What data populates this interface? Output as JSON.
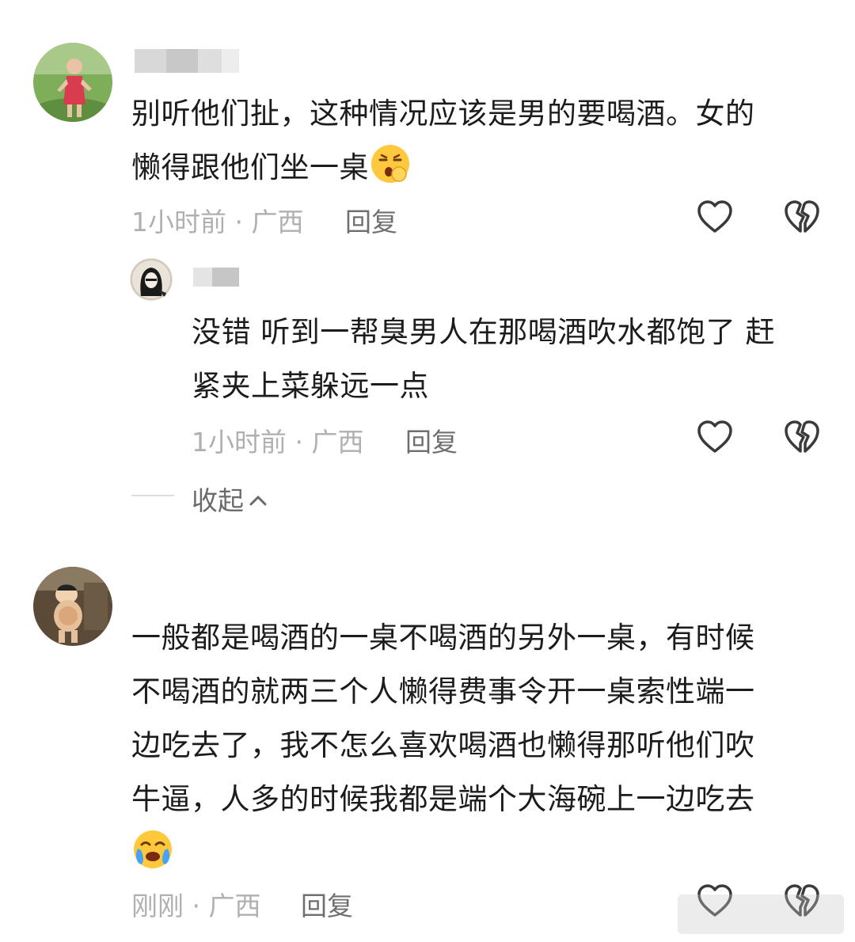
{
  "comments": [
    {
      "text_lines": [
        "别听他们扯，这种情况应该是男的要喝酒。女的",
        "懒得跟他们坐一桌"
      ],
      "meta": "1小时前 · 广西",
      "reply_label": "回复"
    },
    {
      "text_lines": [
        "没错 听到一帮臭男人在那喝酒吹水都饱了 赶",
        "紧夹上菜躲远一点"
      ],
      "meta": "1小时前 · 广西",
      "reply_label": "回复"
    },
    {
      "text_lines": [
        "一般都是喝酒的一桌不喝酒的另外一桌，有时候",
        "不喝酒的就两三个人懒得费事令开一桌索性端一",
        "边吃去了，我不怎么喜欢喝酒也懒得那听他们吹",
        "牛逼，人多的时候我都是端个大海碗上一边吃去"
      ],
      "meta": "刚刚 · 广西",
      "reply_label": "回复"
    }
  ],
  "collapse_label": "收起",
  "icons": {
    "like": "heart-outline-icon",
    "dislike": "broken-heart-icon",
    "collapse": "chevron-up-icon"
  },
  "colors": {
    "text": "#1c1c1c",
    "meta": "#b0b0b0",
    "reply": "#6f6f6f",
    "icon": "#3a3a3a"
  }
}
